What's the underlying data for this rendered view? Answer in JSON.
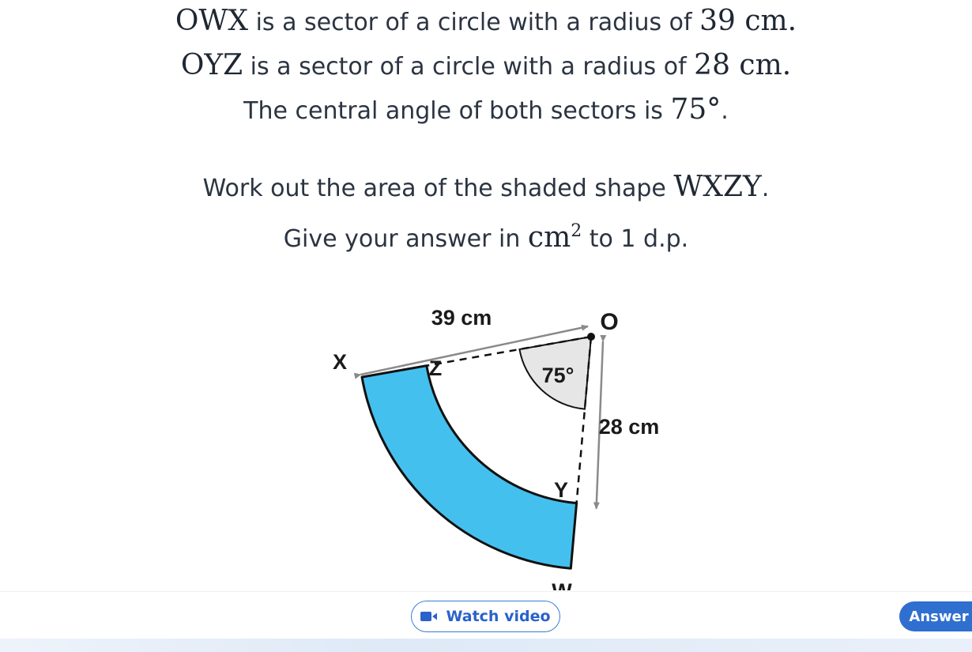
{
  "question": {
    "line1": {
      "math_a": "OWX",
      "text_a": " is a sector of a circle with a radius of ",
      "math_b": "39 cm",
      "text_b": "."
    },
    "line2": {
      "math_a": "OYZ",
      "text_a": " is a sector of a circle with a radius of ",
      "math_b": "28 cm",
      "text_b": "."
    },
    "line3": {
      "text_a": "The central angle of both sectors is ",
      "math_b": "75°",
      "text_b": "."
    },
    "line4": {
      "text_a": "Work out the area of the shaded shape ",
      "math_b": "WXZY",
      "text_b": "."
    },
    "line5": {
      "text_a": "Give your answer in ",
      "math_b": "cm",
      "sup": "2",
      "text_b": " to 1 d.p."
    }
  },
  "diagram": {
    "outer_radius_label": "39 cm",
    "inner_radius_label": "28 cm",
    "angle_label": "75°",
    "point_o": "O",
    "point_x": "X",
    "point_z": "Z",
    "point_y": "Y",
    "point_w": "W",
    "shaded_color": "#44c0ee",
    "angle_color": "#e6e6e6"
  },
  "footer": {
    "watch_video_label": "Watch video",
    "watch_video_icon": "video-camera-icon",
    "answer_label": "Answer"
  }
}
